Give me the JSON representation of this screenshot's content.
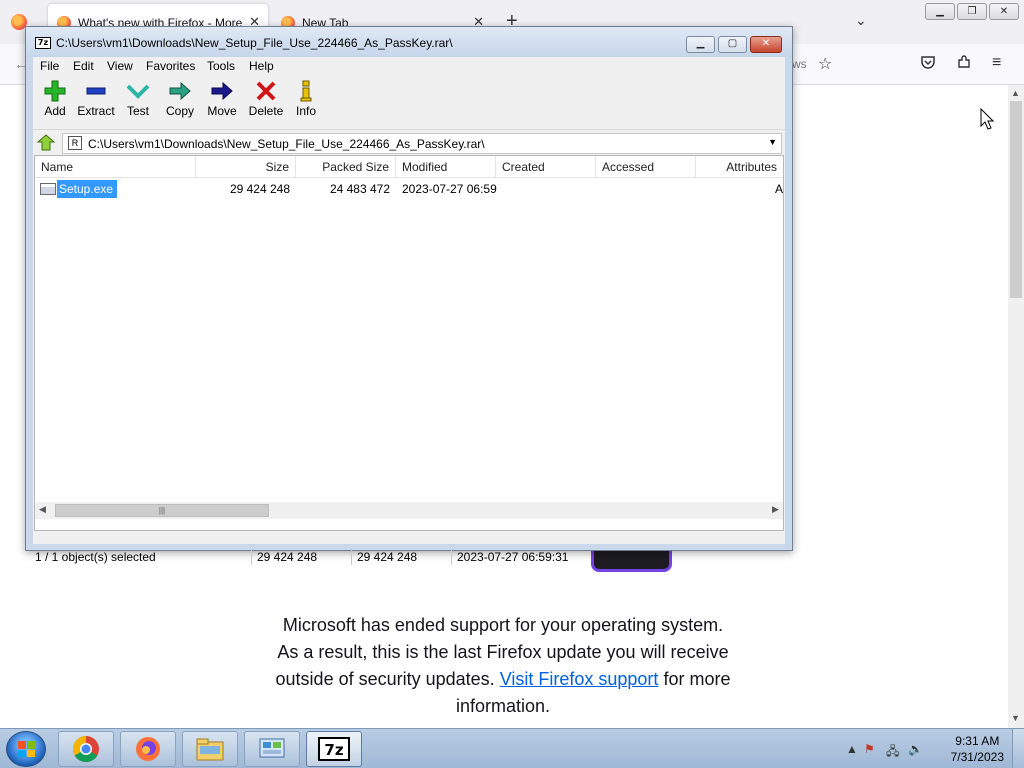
{
  "firefox": {
    "tabs": [
      {
        "title": "What's new with Firefox - More"
      },
      {
        "title": "New Tab"
      }
    ],
    "new_tab_label": "+",
    "url_tail": "ws",
    "message_line1": "Microsoft has ended support for your operating system.",
    "message_line2": "As a result, this is the last Firefox update you will receive",
    "message_line3_pre": "outside of security updates.",
    "message_link": "Visit Firefox support",
    "message_line3_post": "for more",
    "message_line4": "information."
  },
  "zip": {
    "app_icon_text": "7z",
    "title": "C:\\Users\\vm1\\Downloads\\New_Setup_File_Use_224466_As_PassKey.rar\\",
    "menu": [
      "File",
      "Edit",
      "View",
      "Favorites",
      "Tools",
      "Help"
    ],
    "toolbar": [
      {
        "label": "Add",
        "icon": "add-icon"
      },
      {
        "label": "Extract",
        "icon": "extract-icon"
      },
      {
        "label": "Test",
        "icon": "test-icon"
      },
      {
        "label": "Copy",
        "icon": "copy-icon"
      },
      {
        "label": "Move",
        "icon": "move-icon"
      },
      {
        "label": "Delete",
        "icon": "delete-icon"
      },
      {
        "label": "Info",
        "icon": "info-icon"
      }
    ],
    "address": "C:\\Users\\vm1\\Downloads\\New_Setup_File_Use_224466_As_PassKey.rar\\",
    "columns": [
      "Name",
      "Size",
      "Packed Size",
      "Modified",
      "Created",
      "Accessed",
      "Attributes"
    ],
    "files": [
      {
        "name": "Setup.exe",
        "size": "29 424 248",
        "packed": "24 483 472",
        "modified": "2023-07-27 06:59",
        "created": "",
        "accessed": "",
        "attr": "A"
      }
    ],
    "status": {
      "selected": "1 / 1 object(s) selected",
      "size": "29 424 248",
      "size2": "29 424 248",
      "modified": "2023-07-27 06:59:31"
    },
    "accent_color": "#3399ff"
  },
  "taskbar": {
    "time": "9:31 AM",
    "date": "7/31/2023",
    "pinned": [
      "chrome-icon",
      "firefox-icon",
      "file-explorer-icon",
      "control-panel-icon",
      "7zip-icon"
    ]
  }
}
